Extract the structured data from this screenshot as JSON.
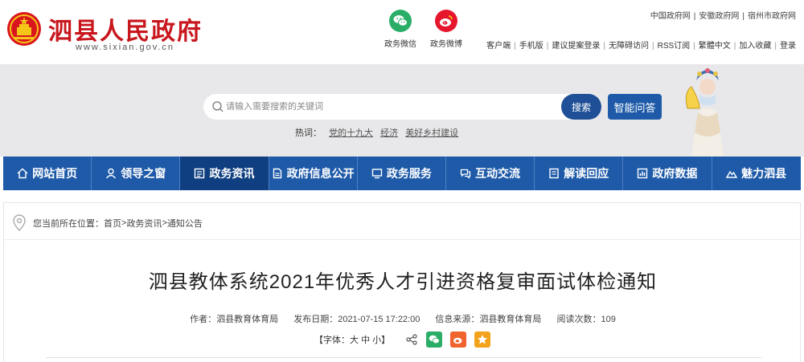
{
  "header": {
    "site_name": "泗县人民政府",
    "site_domain": "www.sixian.gov.cn",
    "social": [
      {
        "label": "政务微信",
        "icon": "wechat-icon",
        "color": "#2aae67"
      },
      {
        "label": "政务微博",
        "icon": "weibo-icon",
        "color": "#e6162d"
      }
    ],
    "gov_links": [
      "中国政府网",
      "安徽政府网",
      "宿州市政府网"
    ],
    "util_links": [
      "客户端",
      "手机版",
      "建议提案登录",
      "无障碍访问",
      "RSS订阅",
      "繁體中文",
      "加入收藏",
      "登录"
    ]
  },
  "search": {
    "placeholder": "请输入需要搜索的关键词",
    "button": "搜索",
    "ai_button": "智能问答",
    "hot_label": "热词：",
    "hot_words": [
      "党的十九大",
      "经济",
      "美好乡村建设"
    ]
  },
  "nav": {
    "items": [
      {
        "label": "网站首页",
        "icon": "home-icon"
      },
      {
        "label": "领导之窗",
        "icon": "person-icon"
      },
      {
        "label": "政务资讯",
        "icon": "news-icon"
      },
      {
        "label": "政府信息公开",
        "icon": "document-icon"
      },
      {
        "label": "政务服务",
        "icon": "monitor-icon"
      },
      {
        "label": "互动交流",
        "icon": "chat-icon"
      },
      {
        "label": "解读回应",
        "icon": "interpret-icon"
      },
      {
        "label": "政府数据",
        "icon": "data-icon"
      },
      {
        "label": "魅力泗县",
        "icon": "mountain-icon"
      }
    ],
    "active_index": 2
  },
  "breadcrumb": {
    "prefix": "您当前所在位置：",
    "items": [
      "首页",
      "政务资讯",
      "通知公告"
    ],
    "separator": " > "
  },
  "article": {
    "title": "泗县教体系统2021年优秀人才引进资格复审面试体检通知",
    "author": "作者：泗县教育体育局",
    "date": "发布日期：2021-07-15 17:22:00",
    "source": "信息来源：泗县教育体育局",
    "views": "阅读次数：109",
    "font_label": "【字体：",
    "font_large": "大",
    "font_medium": "中",
    "font_small": "小",
    "font_close": "】"
  },
  "colors": {
    "brand_red": "#c8161d",
    "nav_blue": "#1e5aa8",
    "nav_active": "#0f3f80",
    "search_btn": "#1e4f97"
  }
}
